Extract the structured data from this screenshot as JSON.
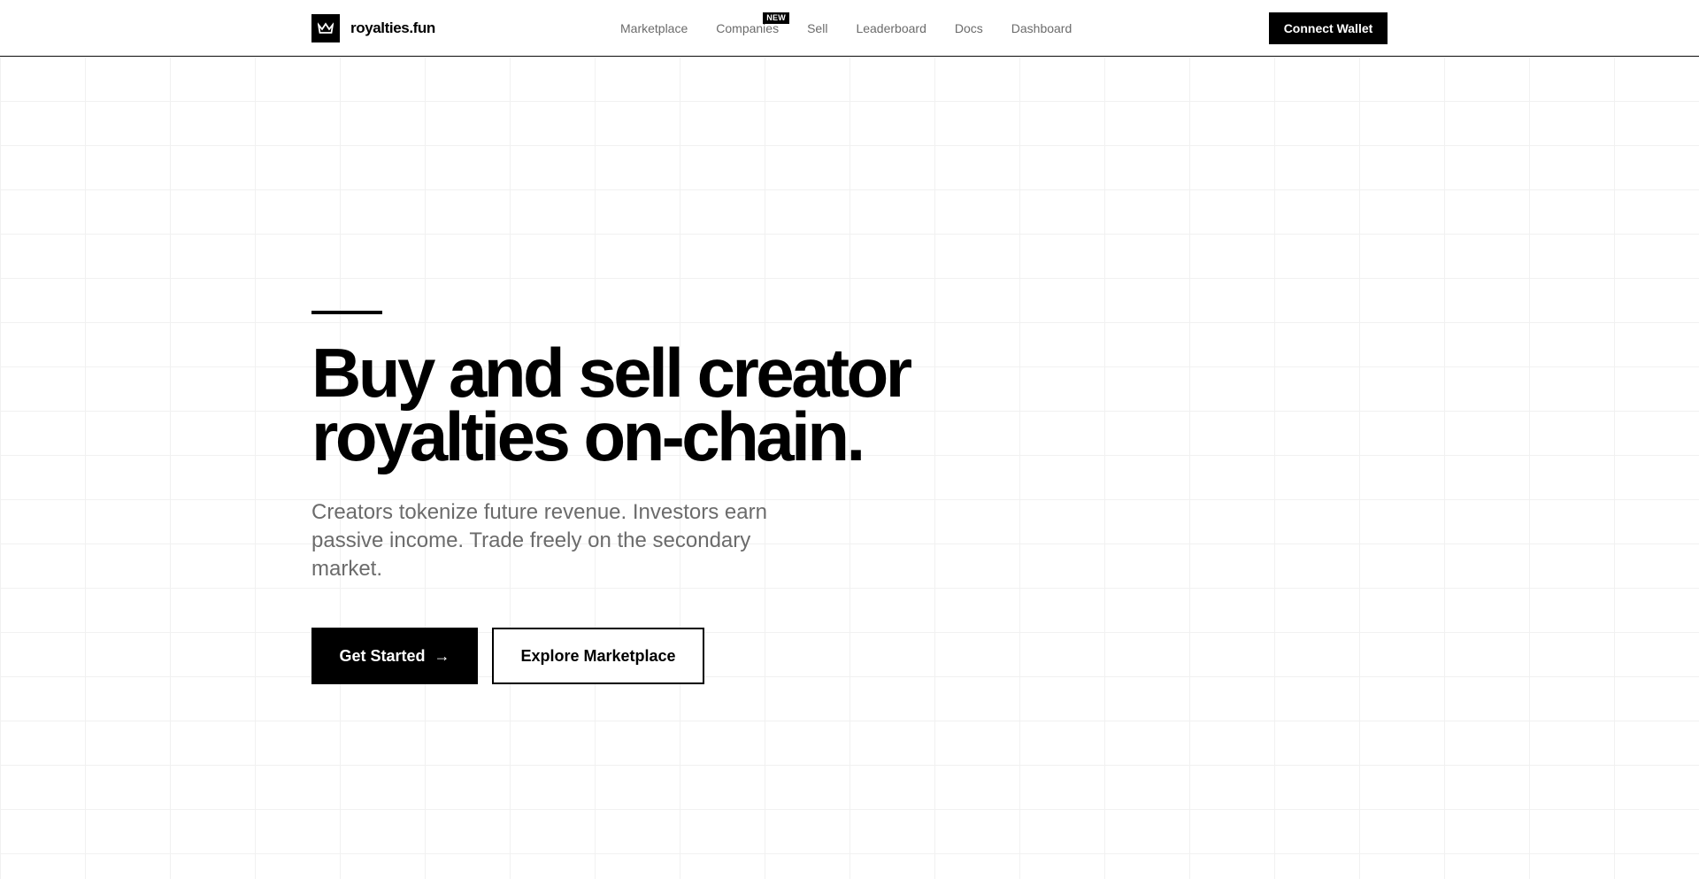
{
  "brand": {
    "name": "royalties.fun",
    "logo_icon": "crown-icon"
  },
  "nav": {
    "items": [
      {
        "label": "Marketplace"
      },
      {
        "label": "Companies",
        "badge": "NEW"
      },
      {
        "label": "Sell"
      },
      {
        "label": "Leaderboard"
      },
      {
        "label": "Docs"
      },
      {
        "label": "Dashboard"
      }
    ]
  },
  "header": {
    "connect_label": "Connect Wallet"
  },
  "hero": {
    "title_line1": "Buy and sell creator",
    "title_line2": "royalties on-chain.",
    "subtitle": "Creators tokenize future revenue. Investors earn passive income. Trade freely on the secondary market.",
    "primary_label": "Get Started",
    "primary_arrow": "→",
    "secondary_label": "Explore Marketplace"
  },
  "colors": {
    "accent": "#000000",
    "muted_text": "#6b6b6b",
    "grid_line": "#f1f1f1",
    "background": "#ffffff"
  }
}
